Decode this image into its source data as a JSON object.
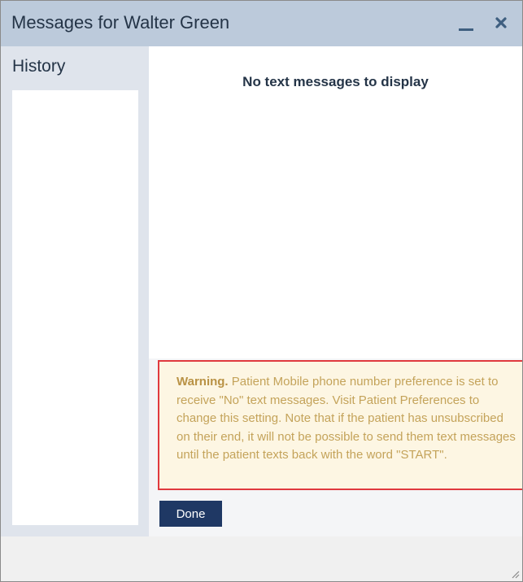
{
  "window": {
    "title": "Messages for Walter Green",
    "minimize_icon": "minimize-icon",
    "close_icon": "close-icon"
  },
  "history": {
    "title": "History",
    "items": []
  },
  "messages": {
    "empty_text": "No text messages to display"
  },
  "warning": {
    "label": "Warning.",
    "text": " Patient Mobile phone number preference is set to receive \"No\" text messages. Visit Patient Preferences to change this setting. Note that if the patient has unsubscribed on their end, it will not be possible to send them text messages until the patient texts back with the word \"START\"."
  },
  "actions": {
    "done_label": "Done"
  },
  "colors": {
    "titlebar": "#bccadb",
    "accent": "#1f3864",
    "warning_border": "#e0393e",
    "warning_bg": "#fdf6e3",
    "warning_text": "#c4a35a"
  }
}
